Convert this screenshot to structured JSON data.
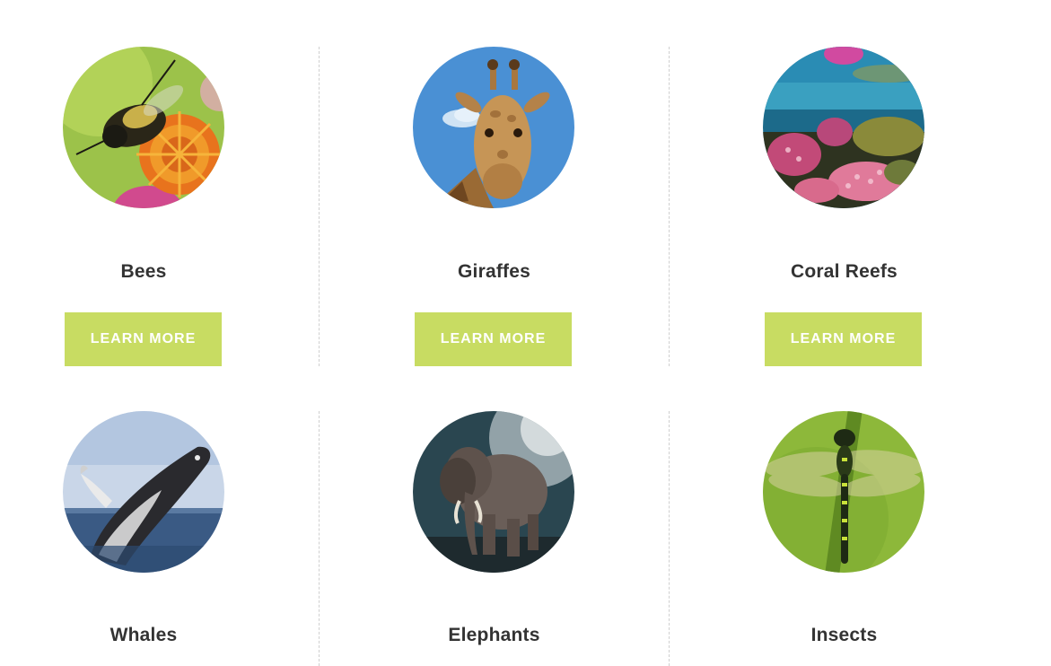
{
  "cards": [
    {
      "title": "Bees",
      "button": "LEARN MORE",
      "image_icon": "bee-on-flower"
    },
    {
      "title": "Giraffes",
      "button": "LEARN MORE",
      "image_icon": "giraffe-head"
    },
    {
      "title": "Coral Reefs",
      "button": "LEARN MORE",
      "image_icon": "coral-reef"
    },
    {
      "title": "Whales",
      "image_icon": "breaching-whale"
    },
    {
      "title": "Elephants",
      "image_icon": "elephant"
    },
    {
      "title": "Insects",
      "image_icon": "dragonfly"
    }
  ],
  "colors": {
    "button_background": "#c8dc62",
    "button_text": "#ffffff",
    "title_text": "#333333",
    "divider": "#cfcfcf"
  }
}
